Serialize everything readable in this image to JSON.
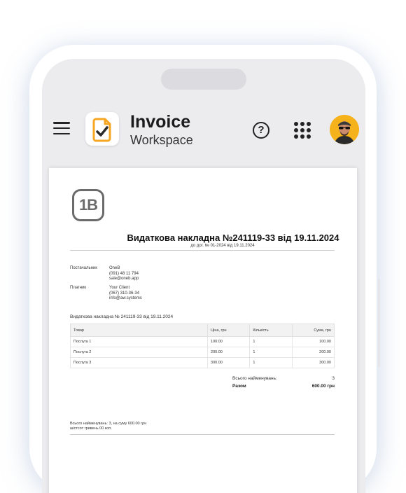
{
  "app": {
    "title": "Invoice",
    "subtitle": "Workspace"
  },
  "header": {
    "help_label": "?",
    "icons": [
      "menu-icon",
      "invoice-logo-icon",
      "help-icon",
      "apps-grid-icon",
      "user-avatar"
    ]
  },
  "colors": {
    "logo_orange": "#f5a623",
    "avatar_bg": "#f6b21a",
    "screen_bg": "#ececef"
  },
  "document": {
    "logo_text": "1B",
    "title": "Видаткова накладна №241119-33 від 19.11.2024",
    "subtitle": "до дог. № 01-2024 від 19.11.2024",
    "supplier": {
      "label": "Постачальник",
      "name": "OneB",
      "phone": "(091) 48 11 794",
      "email": "sale@oneb.app"
    },
    "payer": {
      "label": "Платник",
      "name": "Your Client",
      "phone": "(067) 310-36-34",
      "email": "info@aw.systems"
    },
    "invoice_line": "Видаткова накладна № 241119-33 від 19.11.2024",
    "table": {
      "headers": [
        "Товар",
        "Ціна, грн",
        "Кількість",
        "Сума, грн"
      ],
      "rows": [
        [
          "Послуга 1",
          "100.00",
          "1",
          "100.00"
        ],
        [
          "Послуга 2",
          "200.00",
          "1",
          "200.00"
        ],
        [
          "Послуга 3",
          "300.00",
          "1",
          "300.00"
        ]
      ]
    },
    "total_items_label": "Всього найменувань:",
    "total_items_value": "3",
    "total_label": "Разом",
    "total_value": "600.00 грн",
    "words_line1": "Всього найменувань: 3, на суму 600.00 грн",
    "words_line2": "шістсот гривень 00 коп."
  }
}
